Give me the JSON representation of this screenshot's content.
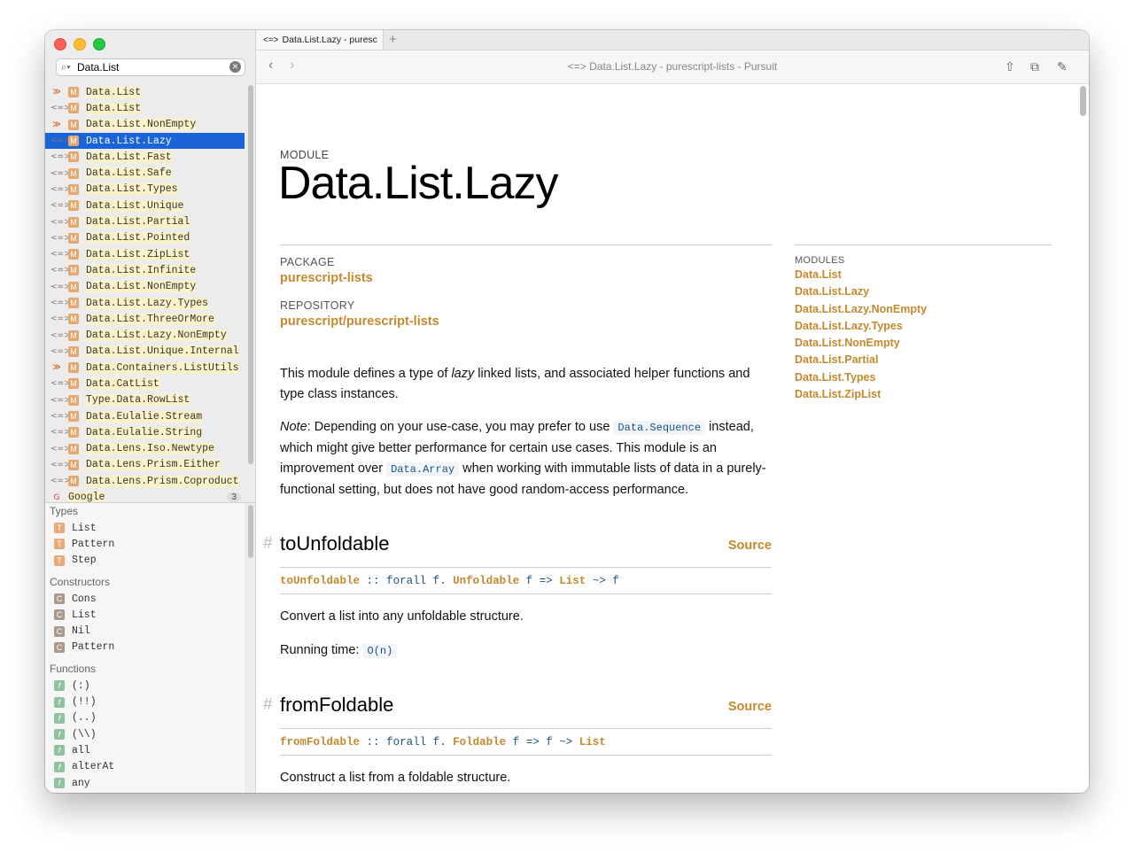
{
  "sidebar": {
    "search_value": "Data.List",
    "results": [
      {
        "src": "x",
        "label": "Data.List"
      },
      {
        "src": "l",
        "label": "Data.List"
      },
      {
        "src": "x",
        "label": "Data.List.NonEmpty"
      },
      {
        "src": "l",
        "label": "Data.List.Lazy",
        "selected": true
      },
      {
        "src": "l",
        "label": "Data.List.Fast"
      },
      {
        "src": "l",
        "label": "Data.List.Safe"
      },
      {
        "src": "l",
        "label": "Data.List.Types"
      },
      {
        "src": "l",
        "label": "Data.List.Unique"
      },
      {
        "src": "l",
        "label": "Data.List.Partial"
      },
      {
        "src": "l",
        "label": "Data.List.Pointed"
      },
      {
        "src": "l",
        "label": "Data.List.ZipList"
      },
      {
        "src": "l",
        "label": "Data.List.Infinite"
      },
      {
        "src": "l",
        "label": "Data.List.NonEmpty"
      },
      {
        "src": "l",
        "label": "Data.List.Lazy.Types"
      },
      {
        "src": "l",
        "label": "Data.List.ThreeOrMore"
      },
      {
        "src": "l",
        "label": "Data.List.Lazy.NonEmpty"
      },
      {
        "src": "l",
        "label": "Data.List.Unique.Internal"
      },
      {
        "src": "x",
        "label": "Data.Containers.ListUtils"
      },
      {
        "src": "l",
        "label": "Data.CatList"
      },
      {
        "src": "l",
        "label": "Type.Data.RowList"
      },
      {
        "src": "l",
        "label": "Data.Eulalie.Stream"
      },
      {
        "src": "l",
        "label": "Data.Eulalie.String"
      },
      {
        "src": "l",
        "label": "Data.Lens.Iso.Newtype"
      },
      {
        "src": "l",
        "label": "Data.Lens.Prism.Either"
      },
      {
        "src": "l",
        "label": "Data.Lens.Prism.Coproduct"
      },
      {
        "src": "g",
        "label": "Google",
        "count": "3"
      }
    ],
    "badge_module": "M",
    "symbols": {
      "types_heading": "Types",
      "types": [
        "List",
        "Pattern",
        "Step"
      ],
      "constructors_heading": "Constructors",
      "constructors": [
        "Cons",
        "List",
        "Nil",
        "Pattern"
      ],
      "functions_heading": "Functions",
      "functions": [
        "(:)",
        "(!!)",
        "(..)",
        "(\\\\)",
        "all",
        "alterAt",
        "any"
      ],
      "badge_type": "T",
      "badge_constructor": "C",
      "badge_function": "f"
    }
  },
  "tab": {
    "title": "Data.List.Lazy - puresc",
    "add": "+"
  },
  "toolbar": {
    "title": "Data.List.Lazy - purescript-lists - Pursuit",
    "back": "‹",
    "forward": "›"
  },
  "page": {
    "kicker": "MODULE",
    "title": "Data.List.Lazy",
    "package_label": "PACKAGE",
    "package": "purescript-lists",
    "repository_label": "REPOSITORY",
    "repository": "purescript/purescript-lists",
    "modules_label": "MODULES",
    "modules": [
      "Data.List",
      "Data.List.Lazy",
      "Data.List.Lazy.NonEmpty",
      "Data.List.Lazy.Types",
      "Data.List.NonEmpty",
      "Data.List.Partial",
      "Data.List.Types",
      "Data.List.ZipList"
    ],
    "intro_1a": "This module defines a type of ",
    "intro_1b": "lazy",
    "intro_1c": " linked lists, and associated helper functions and type class instances.",
    "note_label": "Note",
    "note_a": ": Depending on your use-case, you may prefer to use ",
    "note_code1": "Data.Sequence",
    "note_b": " instead, which might give better performance for certain use cases. This module is an improvement over ",
    "note_code2": "Data.Array",
    "note_c": " when working with immutable lists of data in a purely-functional setting, but does not have good random-access performance.",
    "decls": [
      {
        "name": "toUnfoldable",
        "source": "Source",
        "sig": {
          "name": "toUnfoldable",
          "dc": "::",
          "forall": "forall",
          "var": "f.",
          "cls": "Unfoldable",
          "v2": "f",
          "arrow": "=>",
          "t1": "List",
          "arrow2": "~>",
          "t2": "f"
        },
        "desc": "Convert a list into any unfoldable structure.",
        "rt_label": "Running time:",
        "rt_code": "O(n)"
      },
      {
        "name": "fromFoldable",
        "source": "Source",
        "sig": {
          "name": "fromFoldable",
          "dc": "::",
          "forall": "forall",
          "var": "f.",
          "cls": "Foldable",
          "v2": "f",
          "arrow": "=>",
          "t1": "f",
          "arrow2": "~>",
          "t2": "List"
        },
        "desc": "Construct a list from a foldable structure."
      }
    ],
    "hash": "#"
  },
  "colors": {
    "accent": "#c4892e",
    "code_blue": "#195386",
    "selection": "#1a63d8",
    "match_highlight": "#fbf2c8"
  }
}
